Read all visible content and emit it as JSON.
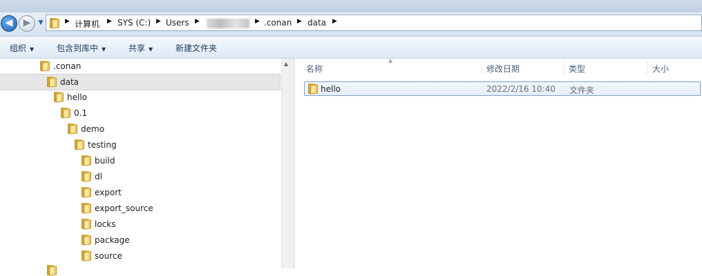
{
  "navigation": {
    "back_glyph": "◀",
    "forward_glyph": "▶",
    "breadcrumbs": [
      "计算机",
      "SYS (C:)",
      "Users",
      ".conan",
      "data"
    ]
  },
  "toolbar": {
    "items": [
      "组织",
      "包含到库中",
      "共享",
      "新建文件夹"
    ]
  },
  "tree": {
    "items": [
      ".conan",
      "data",
      "hello",
      "0.1",
      "demo",
      "testing",
      "build",
      "dl",
      "export",
      "export_source",
      "locks",
      "package",
      "source"
    ]
  },
  "columns": {
    "name": "名称",
    "date": "修改日期",
    "type": "类型",
    "size": "大小"
  },
  "files": [
    {
      "name": "hello",
      "date": "2022/2/16 10:40",
      "type": "文件夹",
      "size": ""
    }
  ],
  "colors": {
    "accent": "#1f5fb0",
    "selection": "#e6eef9",
    "toolbar_text": "#1e395b"
  }
}
